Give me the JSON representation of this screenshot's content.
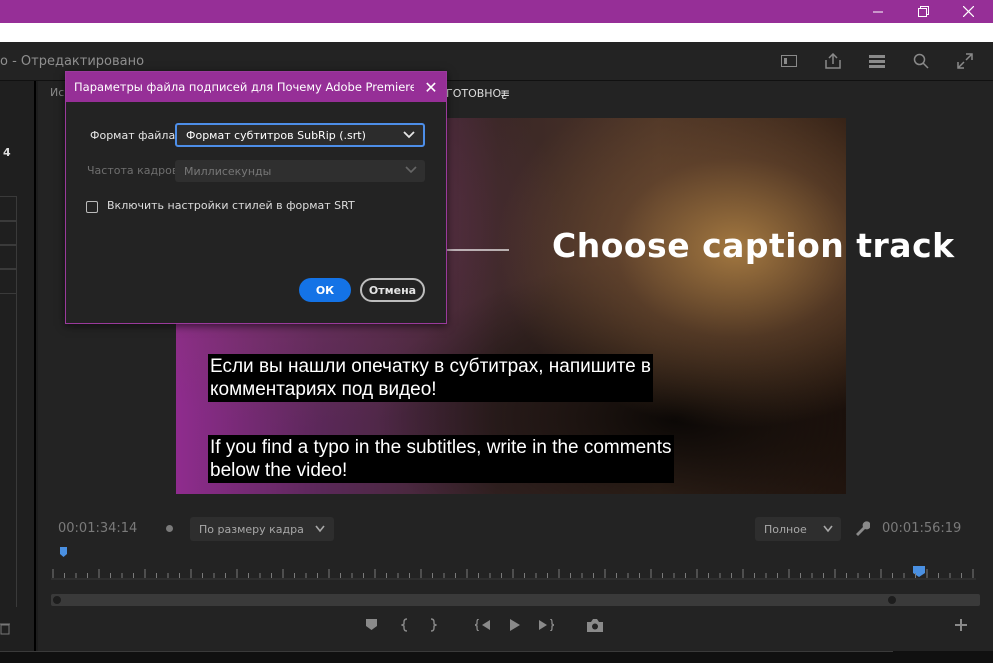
{
  "app": {
    "document_title": "о - Отредактировано"
  },
  "window": {
    "minimize_icon": "minimize-icon",
    "restore_icon": "restore-icon",
    "close_icon": "close-icon",
    "titlebar_color": "#962f97"
  },
  "monitor": {
    "tab_left": "Ис",
    "tab_right": "ГОТОВНО¿",
    "tab_menu": "≡"
  },
  "dialog": {
    "title": "Параметры файла подписей для Почему Adobe Premiere Pr...",
    "close": "✕",
    "format_label": "Формат файла:",
    "format_value": "Формат субтитров SubRip (.srt)",
    "frame_rate_label": "Частота кадров:",
    "frame_rate_value": "Миллисекунды",
    "style_checkbox_label": "Включить настройки стилей в формат SRT",
    "style_checkbox_checked": false,
    "ok_label": "ОК",
    "cancel_label": "Отмена"
  },
  "video": {
    "subtitle_ru_line1": "Если вы нашли опечатку в субтитрах, напишите в",
    "subtitle_ru_line2": "комментариях под видео!",
    "subtitle_en_line1": "If you find a typo in the subtitles, write in the comments",
    "subtitle_en_line2": "below the video!"
  },
  "annotation": {
    "text": "Choose caption track"
  },
  "controls": {
    "current_time": "00:01:34:14",
    "fit_dropdown": "По размеру кадра",
    "quality_dropdown": "Полное",
    "duration": "00:01:56:19"
  },
  "left_panel": {
    "number": "4"
  },
  "colors": {
    "accent_blue": "#1473e6",
    "focus_blue": "#4d8ee8",
    "playhead_blue": "#4a90e2"
  }
}
